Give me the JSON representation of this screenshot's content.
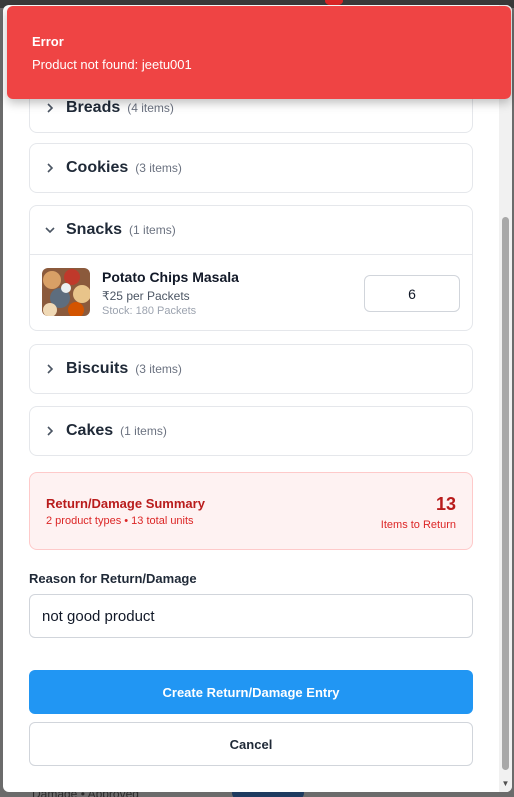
{
  "toast": {
    "title": "Error",
    "message": "Product not found: jeetu001",
    "color": "#ef4444"
  },
  "categories": [
    {
      "name": "Breads",
      "count": "(4 items)",
      "expanded": false
    },
    {
      "name": "Cookies",
      "count": "(3 items)",
      "expanded": false
    },
    {
      "name": "Snacks",
      "count": "(1 items)",
      "expanded": true,
      "products": [
        {
          "name": "Potato Chips Masala",
          "price": "₹25 per Packets",
          "stock": "Stock: 180 Packets",
          "quantity": "6",
          "image": "chips-thumbnail"
        }
      ]
    },
    {
      "name": "Biscuits",
      "count": "(3 items)",
      "expanded": false
    },
    {
      "name": "Cakes",
      "count": "(1 items)",
      "expanded": false
    }
  ],
  "summary": {
    "title": "Return/Damage Summary",
    "subtitle": "2 product types • 13 total units",
    "total": "13",
    "total_label": "Items to Return"
  },
  "reason": {
    "label": "Reason for Return/Damage",
    "value": "not good product"
  },
  "buttons": {
    "create": "Create Return/Damage Entry",
    "cancel": "Cancel"
  },
  "background": {
    "row_text": "Damage • Approved"
  },
  "icons": {
    "collapsed": "chevron-right-icon",
    "expanded": "chevron-down-icon"
  },
  "colors": {
    "primary": "#2196f3",
    "danger": "#b91c1c"
  }
}
